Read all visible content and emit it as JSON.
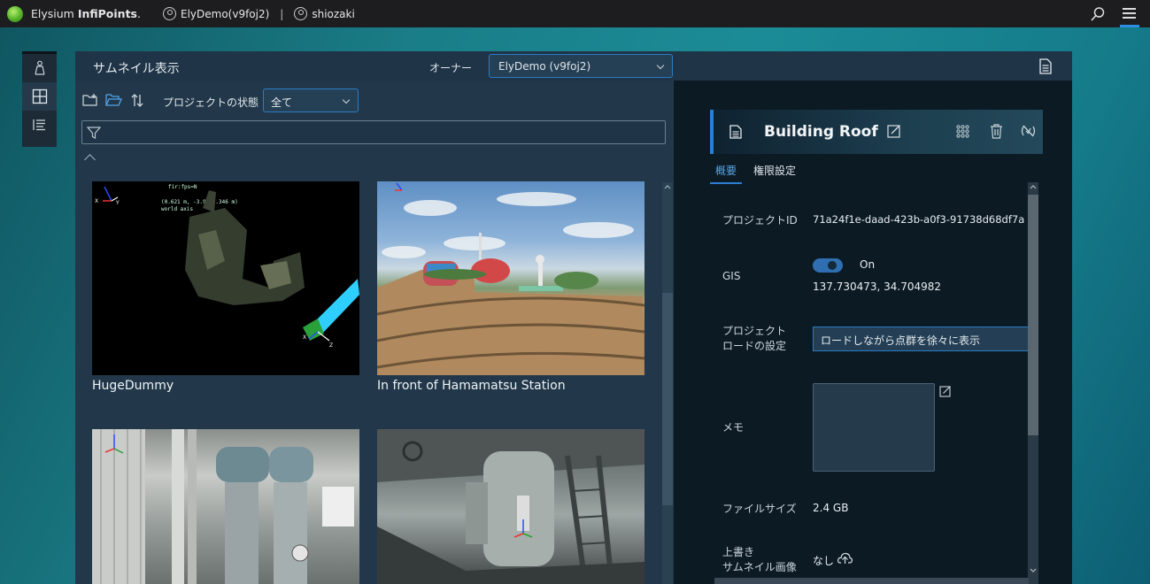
{
  "topbar": {
    "brand_plain": "Elysium ",
    "brand_bold": "InfiPoints",
    "brand_mark": ".",
    "workspace": "ElyDemo(v9foj2)",
    "separator": "|",
    "user": "shiozaki",
    "icons": [
      "search-icon",
      "hamburger-menu-icon"
    ]
  },
  "toolstrip": {
    "icons": [
      "person-icon",
      "grid-view-icon",
      "list-view-icon"
    ]
  },
  "header": {
    "title": "サムネイル表示",
    "owner_label": "オーナー",
    "owner_value": "ElyDemo (v9foj2)"
  },
  "toolbar": {
    "state_label": "プロジェクトの状態",
    "state_value": "全て"
  },
  "projects": [
    {
      "title": "HugeDummy"
    },
    {
      "title": "In front of Hamamatsu Station"
    },
    {
      "title": ""
    },
    {
      "title": ""
    }
  ],
  "thumb_texts": {
    "huge_line1": "fir:fps=N",
    "huge_line2": "(0.621 m, -3.9, 9.346 m)",
    "huge_line3": "world axis",
    "axis_x": "X",
    "axis_y": "Y",
    "axis_z": "Z"
  },
  "detail": {
    "title": "Building Roof",
    "tabs": [
      "概要",
      "権限設定"
    ],
    "project_id_label": "プロジェクトID",
    "project_id_value": "71a24f1e-daad-423b-a0f3-91738d68df7a",
    "gis_label": "GIS",
    "gis_toggle": "On",
    "gis_coords": "137.730473, 34.704982",
    "load_label_1": "プロジェクト",
    "load_label_2": "ロードの設定",
    "load_value": "ロードしながら点群を徐々に表示",
    "memo_label": "メモ",
    "filesize_label": "ファイルサイズ",
    "filesize_value": "2.4 GB",
    "thumb_label_1": "上書き",
    "thumb_label_2": "サムネイル画像",
    "thumb_value": "なし"
  },
  "colors": {
    "accent": "#2b7fd0",
    "topbar": "#1d1d1f",
    "panel": "#22384a"
  }
}
